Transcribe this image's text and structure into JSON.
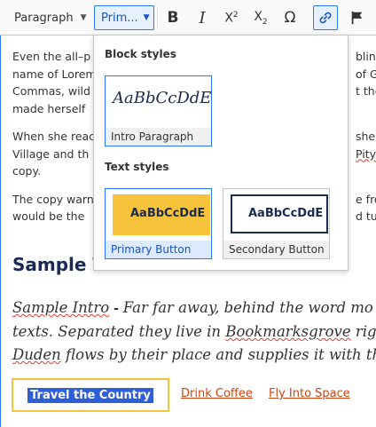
{
  "toolbar": {
    "heading_dropdown": "Paragraph",
    "style_dropdown": "Prim...",
    "bold_glyph": "B",
    "italic_glyph": "I",
    "superscript_glyph": "X",
    "superscript_mark": "2",
    "subscript_glyph": "X",
    "subscript_mark": "2",
    "special_char_glyph": "Ω"
  },
  "editor": {
    "paragraphs": [
      {
        "left": [
          "Even the all–p",
          "name of Lorem",
          "Commas, wild",
          "made herself"
        ],
        "right": [
          "blind",
          "of G",
          "t the",
          ""
        ]
      },
      {
        "left": [
          "When she reac",
          "Village and th",
          "copy."
        ],
        "right": [
          "she h",
          "Pityfu",
          ""
        ]
      },
      {
        "left": [
          "The copy warn",
          "would be the"
        ],
        "right": [
          "e fro",
          "d turn"
        ]
      }
    ],
    "heading": "Sample T",
    "intro_lines": [
      [
        "Sample Intro",
        " - ",
        "Far far away, behind the word mo"
      ],
      [
        "texts. Separated they live in ",
        "Bookmarksgrove",
        " righ"
      ],
      [
        "Duden",
        " flows by their place and supplies it with th"
      ]
    ],
    "cta_primary": "Travel the Country",
    "cta_links": [
      "Drink Coffee",
      "Fly Into Space"
    ]
  },
  "style_panel": {
    "block_title": "Block styles",
    "text_title": "Text styles",
    "block_styles": [
      {
        "preview": "AaBbCcDdE",
        "label": "Intro Paragraph"
      }
    ],
    "text_styles": [
      {
        "preview": "AaBbCcDdE",
        "label": "Primary Button",
        "selected": true
      },
      {
        "preview": "AaBbCcDdE",
        "label": "Secondary Button",
        "selected": false
      }
    ]
  },
  "colors": {
    "accent": "#2977ff",
    "heading": "#1a2a52",
    "primary_yellow": "#f6c33b",
    "link_orange": "#d1420f",
    "selection_blue": "#2f5fd6"
  }
}
